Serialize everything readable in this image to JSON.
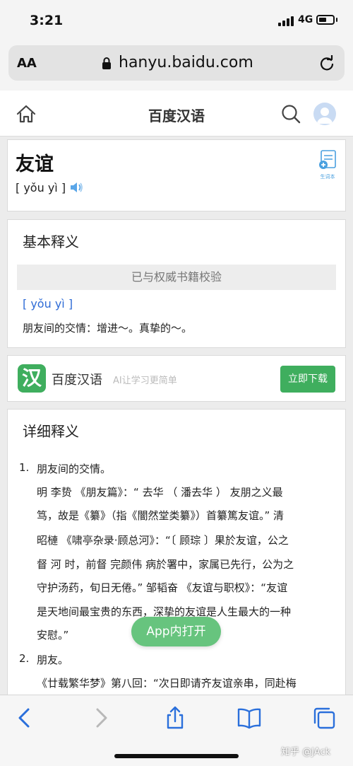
{
  "status": {
    "time": "3:21",
    "network": "4G",
    "battery_level": 0.55
  },
  "browser": {
    "text_size": "AA",
    "domain": "hanyu.baidu.com"
  },
  "site_header": {
    "brand": "百度汉语"
  },
  "word_card": {
    "word": "友谊",
    "pinyin": "[ yǒu yì ]",
    "vocab_label": "生词本"
  },
  "basic": {
    "title": "基本释义",
    "verified": "已与权威书籍校验",
    "pinyin": "[ yǒu yì ]",
    "definition": "朋友间的交情：增进～。真挚的～。"
  },
  "app_banner": {
    "logo_char": "汉",
    "name": "百度汉语",
    "slogan": "AI让学习更简单",
    "download": "立即下载"
  },
  "detail": {
    "title": "详细释义",
    "items": [
      {
        "number": "1.",
        "heading": "朋友间的交情。",
        "lines": [
          "明 李贽 《朋友篇》：“ 去华 （ 潘去华 ） 友朋之义最",
          "笃，故是《纂》（指《闇然堂类纂》）首纂篤友谊。” 清",
          "昭槤 《啸亭杂录·顾总河》：“〔 顾琮 〕果於友谊，公之",
          "督 河 时，前督 完颜伟 病於署中，家属已先行，公为之",
          "守护汤药，旬日无倦。” 邹韬奋 《友谊与职权》：“友谊",
          "是天地间最宝贵的东西，深挚的友谊是人生最大的一种",
          "安慰。”"
        ]
      },
      {
        "number": "2.",
        "heading": "朋友。",
        "lines": [
          "《廿载繁华梦》第八回：“次日即请齐友谊亲串，同赴梅"
        ]
      }
    ]
  },
  "open_app": "App内打开",
  "watermark": "知乎 @JAck",
  "colors": {
    "accent_green": "#3fae5e",
    "link_blue": "#2e6bd6",
    "toolbar_blue": "#2a6fdb"
  }
}
